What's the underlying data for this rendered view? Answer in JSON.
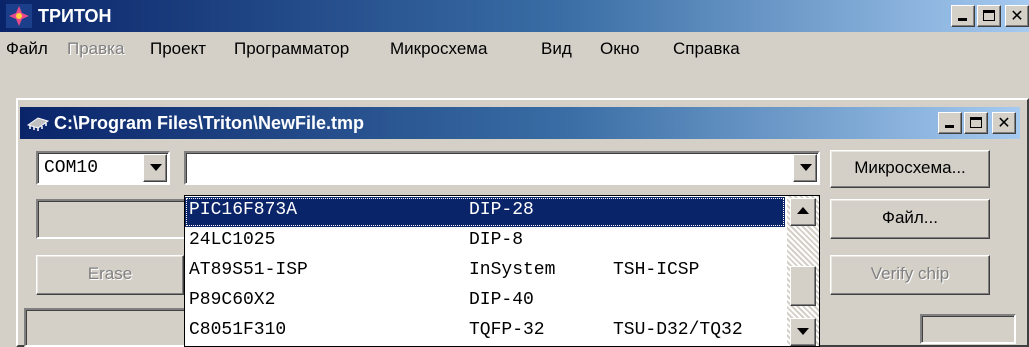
{
  "app": {
    "title": "ТРИТОН"
  },
  "menu": {
    "items": [
      {
        "label": "Файл",
        "enabled": true
      },
      {
        "label": "Правка",
        "enabled": false
      },
      {
        "label": "Проект",
        "enabled": true
      },
      {
        "label": "Программатор",
        "enabled": true
      },
      {
        "label": "Микросхема",
        "enabled": true
      },
      {
        "label": "Вид",
        "enabled": true
      },
      {
        "label": "Окно",
        "enabled": true
      },
      {
        "label": "Справка",
        "enabled": true
      }
    ]
  },
  "window_controls": {
    "minimize": "_",
    "maximize": "□",
    "close": "X"
  },
  "document": {
    "title": "C:\\Program Files\\Triton\\NewFile.tmp",
    "port_select": {
      "value": "COM10"
    },
    "chip_select": {
      "value": ""
    },
    "buttons": {
      "chip": "Микросхема...",
      "file": "Файл...",
      "erase": "Erase",
      "verify": "Verify chip"
    },
    "chip_list": [
      {
        "name": "PIC16F873A",
        "package": "DIP-28",
        "adapter": "",
        "selected": true
      },
      {
        "name": "24LC1025",
        "package": "DIP-8",
        "adapter": "",
        "selected": false
      },
      {
        "name": "AT89S51-ISP",
        "package": "InSystem",
        "adapter": "TSH-ICSP",
        "selected": false
      },
      {
        "name": "P89C60X2",
        "package": "DIP-40",
        "adapter": "",
        "selected": false
      },
      {
        "name": "C8051F310",
        "package": "TQFP-32",
        "adapter": "TSU-D32/TQ32",
        "selected": false
      }
    ]
  },
  "colors": {
    "titlebar_active": "#0a246a",
    "face": "#d4d0c8",
    "selection": "#0a246a"
  }
}
